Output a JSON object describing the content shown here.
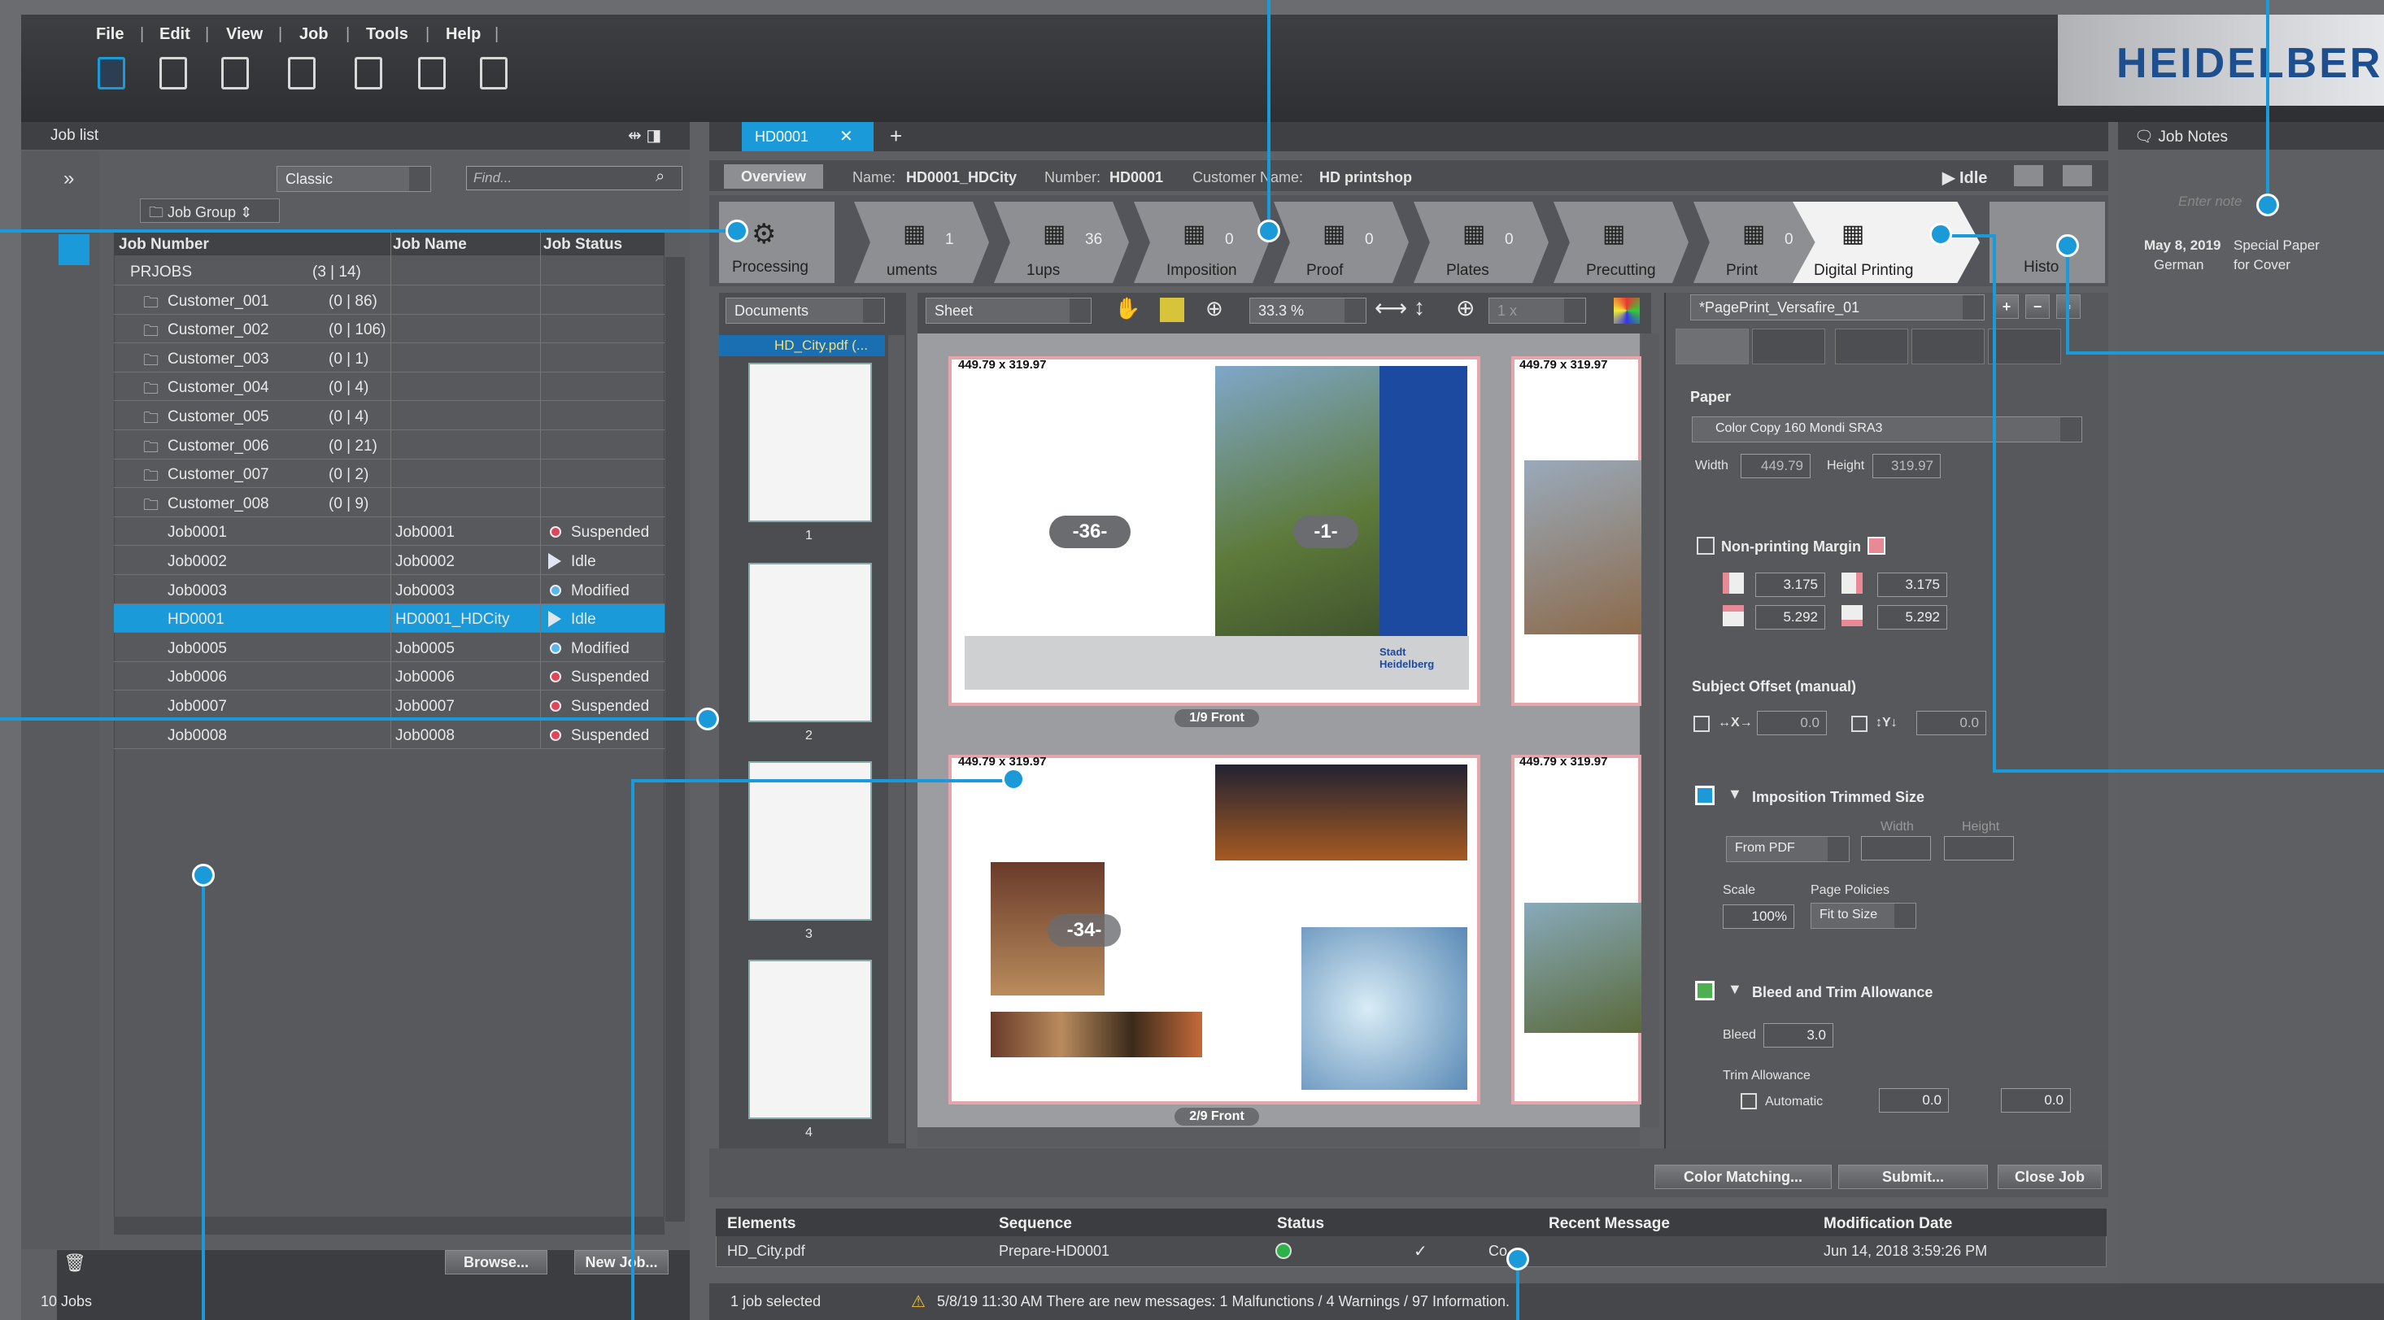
{
  "menu": {
    "items": [
      "File",
      "Edit",
      "View",
      "Job",
      "Tools",
      "Help"
    ]
  },
  "brand": {
    "logo": "HEIDELBERG",
    "accent": "#1a9ad9"
  },
  "joblist": {
    "title": "Job list",
    "view": "Classic",
    "find_placeholder": "Find...",
    "group": "Job Group",
    "columns": [
      "Job Number",
      "Job Name",
      "Job Status"
    ],
    "root": {
      "label": "PRJOBS",
      "count": "(3 | 14)"
    },
    "customers": [
      {
        "label": "Customer_001",
        "count": "(0 | 86)"
      },
      {
        "label": "Customer_002",
        "count": "(0 | 106)"
      },
      {
        "label": "Customer_003",
        "count": "(0 | 1)"
      },
      {
        "label": "Customer_004",
        "count": "(0 | 4)"
      },
      {
        "label": "Customer_005",
        "count": "(0 | 4)"
      },
      {
        "label": "Customer_006",
        "count": "(0 | 21)"
      },
      {
        "label": "Customer_007",
        "count": "(0 | 2)"
      },
      {
        "label": "Customer_008",
        "count": "(0 | 9)"
      }
    ],
    "jobs": [
      {
        "number": "Job0001",
        "name": "Job0001",
        "status": "Suspended",
        "icon": "red-dot"
      },
      {
        "number": "Job0002",
        "name": "Job0002",
        "status": "Idle",
        "icon": "play"
      },
      {
        "number": "Job0003",
        "name": "Job0003",
        "status": "Modified",
        "icon": "blue-dot"
      },
      {
        "number": "HD0001",
        "name": "HD0001_HDCity",
        "status": "Idle",
        "icon": "play",
        "selected": true
      },
      {
        "number": "Job0005",
        "name": "Job0005",
        "status": "Modified",
        "icon": "blue-dot"
      },
      {
        "number": "Job0006",
        "name": "Job0006",
        "status": "Suspended",
        "icon": "red-dot"
      },
      {
        "number": "Job0007",
        "name": "Job0007",
        "status": "Suspended",
        "icon": "red-dot"
      },
      {
        "number": "Job0008",
        "name": "Job0008",
        "status": "Suspended",
        "icon": "red-dot"
      }
    ],
    "browse": "Browse...",
    "new_job": "New Job...",
    "footer": "10 Jobs"
  },
  "tab": {
    "label": "HD0001",
    "overview": "Overview",
    "name_label": "Name:",
    "name": "HD0001_HDCity",
    "number_label": "Number:",
    "number": "HD0001",
    "customer_label": "Customer Name:",
    "customer": "HD printshop",
    "state": "Idle"
  },
  "workflow": {
    "processing": "Processing",
    "steps": [
      {
        "label": "uments",
        "count": "1"
      },
      {
        "label": "1ups",
        "count": "36"
      },
      {
        "label": "Imposition",
        "count": "0"
      },
      {
        "label": "Proof",
        "count": "0"
      },
      {
        "label": "Plates",
        "count": "0"
      },
      {
        "label": "Precutting",
        "count": ""
      },
      {
        "label": "Print",
        "count": "0"
      },
      {
        "label": "Digital Printing",
        "count": ""
      }
    ],
    "history": "Histo"
  },
  "documents": {
    "dropdown": "Documents",
    "file": "HD_City.pdf (...",
    "pages": [
      "1",
      "2",
      "3",
      "4"
    ]
  },
  "viewer": {
    "mode": "Sheet",
    "zoom": "33.3 %",
    "copies": "1 x",
    "size": "449.79 x 319.97",
    "sheet1": "1/9 Front",
    "sheet2": "2/9 Front",
    "badge1": "-36-",
    "badge2": "-1-",
    "badge3": "-34-",
    "city": "Stadt Heidelberg"
  },
  "props": {
    "preset": "*PagePrint_Versafire_01",
    "paper_title": "Paper",
    "paper": "Color Copy 160 Mondi SRA3",
    "width_label": "Width",
    "width": "449.79",
    "height_label": "Height",
    "height": "319.97",
    "npm_title": "Non-printing Margin",
    "m1": "3.175",
    "m2": "3.175",
    "m3": "5.292",
    "m4": "5.292",
    "offset_title": "Subject Offset (manual)",
    "x_label": "↔X→",
    "x": "0.0",
    "y_label": "↕Y↓",
    "y": "0.0",
    "trim_title": "Imposition Trimmed Size",
    "trim_source": "From PDF",
    "scale_label": "Scale",
    "scale": "100%",
    "policies_label": "Page Policies",
    "policy": "Fit to Size",
    "bleed_title": "Bleed and Trim Allowance",
    "bleed_label": "Bleed",
    "bleed": "3.0",
    "trim_allow_label": "Trim Allowance",
    "automatic": "Automatic",
    "ta1": "0.0",
    "ta2": "0.0"
  },
  "notes": {
    "title": "Job Notes",
    "placeholder": "Enter note",
    "date": "May 8, 2019",
    "lang": "German",
    "text1": "Special Paper",
    "text2": "for Cover"
  },
  "actions": {
    "color": "Color Matching...",
    "submit": "Submit...",
    "close": "Close Job"
  },
  "elements": {
    "columns": [
      "Elements",
      "Sequence",
      "Status",
      "Recent Message",
      "Modification Date"
    ],
    "row": {
      "element": "HD_City.pdf",
      "sequence": "Prepare-HD0001",
      "status": "✓",
      "message": "Co...",
      "date": "Jun 14, 2018 3:59:26 PM"
    }
  },
  "statusbar": {
    "selected": "1 job selected",
    "message": "5/8/19 11:30 AM  There are new messages: 1 Malfunctions / 4 Warnings / 97 Information."
  }
}
